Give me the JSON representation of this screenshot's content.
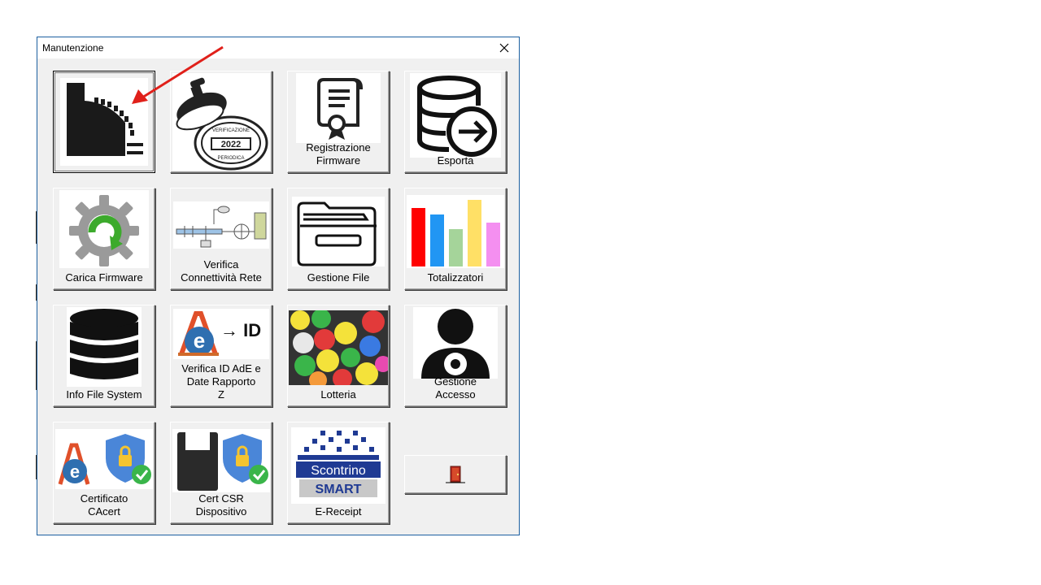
{
  "window": {
    "title": "Manutenzione",
    "close_symbol": "✕"
  },
  "tiles": {
    "memory": {
      "label": ""
    },
    "verification": {
      "label": "",
      "stamp_text": "VERIFICAZIONE",
      "stamp_year": "2022",
      "stamp_sub": "PERIODICA"
    },
    "firmware_registration": {
      "label": "Registrazione\nFirmware"
    },
    "export": {
      "label": "Esporta"
    },
    "load_firmware": {
      "label": "Carica Firmware"
    },
    "network_check": {
      "label": "Verifica\nConnettività Rete"
    },
    "file_management": {
      "label": "Gestione File"
    },
    "totals": {
      "label": "Totalizzatori"
    },
    "fs_info": {
      "label": "Info File System"
    },
    "ade_id": {
      "label": "Verifica ID AdE e\nDate Rapporto\nZ",
      "icon_text": "→ ID"
    },
    "lottery": {
      "label": "Lotteria"
    },
    "access": {
      "label": "Gestione\nAccesso"
    },
    "cacert": {
      "label": "Certificato\nCAcert"
    },
    "csr": {
      "label": "Cert CSR\nDispositivo"
    },
    "ereceipt": {
      "label": "E-Receipt",
      "logo_top": "Scontrino",
      "logo_bottom": "SMART"
    },
    "exit": {
      "label": ""
    }
  },
  "chart_colors": [
    "#ff0000",
    "#2196f3",
    "#a5d49a",
    "#ffe066",
    "#f48ff0"
  ],
  "accent": "#1c5fa0"
}
